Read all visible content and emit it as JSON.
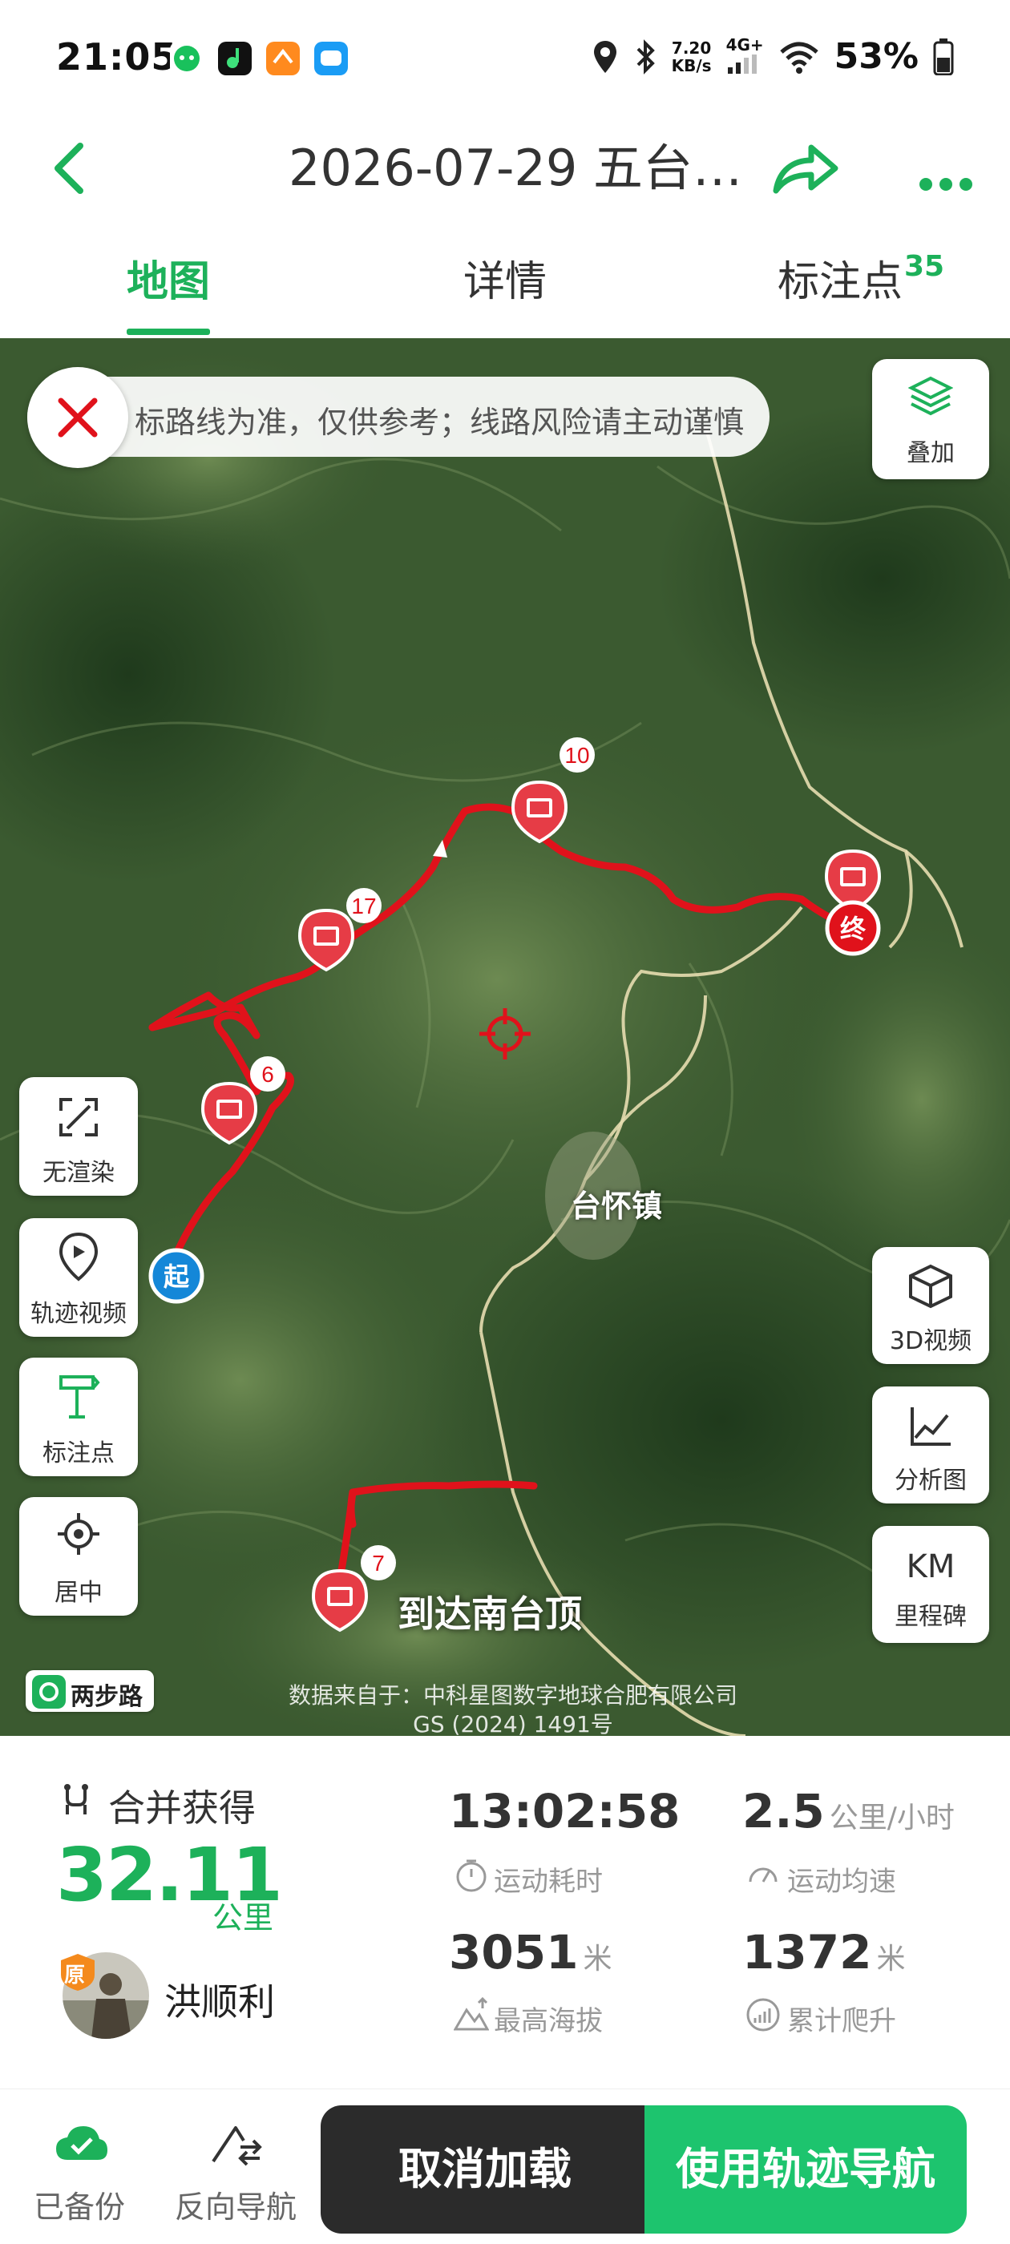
{
  "status_bar": {
    "time": "21:05",
    "speed_top": "7.20",
    "speed_bottom": "KB/s",
    "network": "4G+",
    "battery": "53%"
  },
  "header": {
    "title": "2026-07-29 五台…",
    "icons": [
      "back-arrow-icon",
      "share-icon",
      "more-icon"
    ]
  },
  "tabs": [
    {
      "label": "地图",
      "active": true
    },
    {
      "label": "详情",
      "active": false
    },
    {
      "label": "标注点",
      "active": false,
      "badge": "35"
    }
  ],
  "map": {
    "banner_text": "标路线为准，仅供参考；线路风险请主动谨慎",
    "controls_right": [
      {
        "label": "叠加",
        "icon": "layers-icon"
      },
      {
        "label": "3D视频",
        "icon": "cube-icon"
      },
      {
        "label": "分析图",
        "icon": "chart-icon"
      },
      {
        "label": "里程碑",
        "icon_text": "KM"
      }
    ],
    "controls_left": [
      {
        "label": "无渲染",
        "icon": "expand-icon"
      },
      {
        "label": "轨迹视频",
        "icon": "play-pin-icon"
      },
      {
        "label": "标注点",
        "icon": "signpost-icon"
      },
      {
        "label": "居中",
        "icon": "locate-icon"
      }
    ],
    "markers": [
      {
        "count": "10"
      },
      {
        "count": "17"
      },
      {
        "count": "6"
      },
      {
        "count": "7"
      }
    ],
    "start_label": "起",
    "end_label": "终",
    "town_label": "台怀镇",
    "peak_label": "到达南台顶",
    "logo_text": "两步路",
    "attribution_line1": "数据来自于：中科星图数字地球合肥有限公司",
    "attribution_line2": "GS (2024) 1491号"
  },
  "stats": {
    "merge_label": "合并获得",
    "distance": "32.11",
    "distance_unit": "公里",
    "badge_text": "原",
    "username": "洪顺利",
    "duration": "13:02:58",
    "duration_label": "运动耗时",
    "avg_speed": "2.5",
    "avg_speed_unit": "公里/小时",
    "avg_speed_label": "运动均速",
    "max_altitude": "3051",
    "max_altitude_unit": "米",
    "max_altitude_label": "最高海拔",
    "total_climb": "1372",
    "total_climb_unit": "米",
    "total_climb_label": "累计爬升"
  },
  "bottom": {
    "backup_label": "已备份",
    "reverse_label": "反向导航",
    "cancel_label": "取消加载",
    "navigate_label": "使用轨迹导航"
  },
  "colors": {
    "accent": "#1db15a",
    "track": "#e0121b",
    "nav_button": "#1dc46e",
    "cancel_button": "#2b2b2b"
  }
}
